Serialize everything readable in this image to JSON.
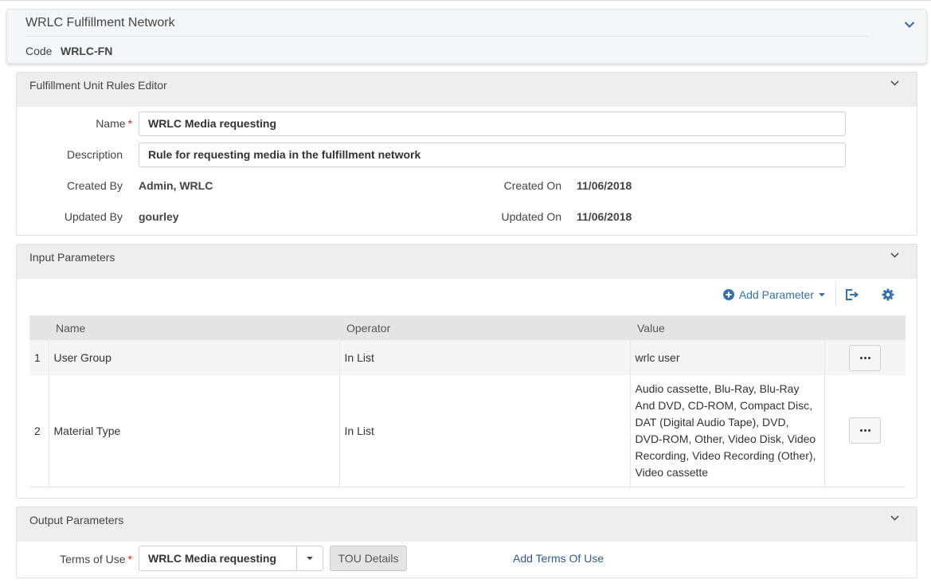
{
  "header": {
    "title": "WRLC Fulfillment Network",
    "code_label": "Code",
    "code_value": "WRLC-FN"
  },
  "editor": {
    "title": "Fulfillment Unit Rules Editor",
    "name_label": "Name",
    "name_value": "WRLC Media requesting",
    "required_mark": "*",
    "description_label": "Description",
    "description_value": "Rule for requesting media in the fulfillment network",
    "created_by_label": "Created By",
    "created_by_value": "Admin, WRLC",
    "created_on_label": "Created On",
    "created_on_value": "11/06/2018",
    "updated_by_label": "Updated By",
    "updated_by_value": "gourley",
    "updated_on_label": "Updated On",
    "updated_on_value": "11/06/2018"
  },
  "input_params": {
    "title": "Input Parameters",
    "add_label": "Add Parameter",
    "columns": [
      "Name",
      "Operator",
      "Value"
    ],
    "rows": [
      {
        "num": "1",
        "name": "User Group",
        "operator": "In List",
        "value": "wrlc user"
      },
      {
        "num": "2",
        "name": "Material Type",
        "operator": "In List",
        "value": "Audio cassette, Blu-Ray, Blu-Ray And DVD, CD-ROM, Compact Disc, DAT (Digital Audio Tape), DVD, DVD-ROM, Other, Video Disk, Video Recording, Video Recording (Other), Video cassette"
      }
    ]
  },
  "output_params": {
    "title": "Output Parameters",
    "terms_label": "Terms of Use",
    "required_mark": "*",
    "terms_value": "WRLC Media requesting",
    "tou_details_label": "TOU Details",
    "add_terms_label": "Add Terms Of Use"
  },
  "colors": {
    "link": "#3771a8",
    "required": "#d9262c",
    "header_bg": "#f4f6f8",
    "section_head_bg": "#eeeeee"
  },
  "icons": [
    "chevron-down-icon",
    "plus-circle-icon",
    "caret-down-icon",
    "export-icon",
    "gear-icon",
    "more-icon"
  ]
}
